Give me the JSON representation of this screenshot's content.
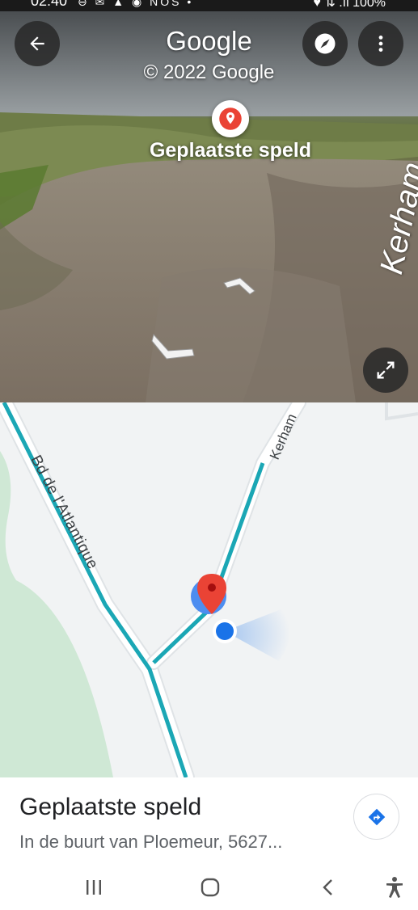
{
  "status_bar": {
    "time": "02:40",
    "notification_icons": "⊖ ✉ ▲ ◉ NOS •",
    "right": "♥ ⇅ .ıl 100%"
  },
  "street_view": {
    "title": "Google",
    "copyright": "© 2022 Google",
    "pin_label": "Geplaatste speld",
    "road_label": "Kerham",
    "icons": [
      "back-arrow-icon",
      "compass-icon",
      "more-vert-icon",
      "place-pin-icon",
      "expand-icon",
      "nav-arrow-icon"
    ]
  },
  "map": {
    "road_labels": [
      "Bd de l'Atlantique",
      "Kerham"
    ],
    "colors": {
      "route": "#1ba7b5",
      "park": "#cfe8d5",
      "pin": "#ea4335",
      "location_dot": "#1a73e8"
    }
  },
  "place": {
    "title": "Geplaatste speld",
    "address": "In de buurt van Ploemeur, 5627..."
  },
  "nav": {
    "icons": [
      "recent-apps-icon",
      "home-icon",
      "back-icon",
      "accessibility-icon"
    ]
  }
}
